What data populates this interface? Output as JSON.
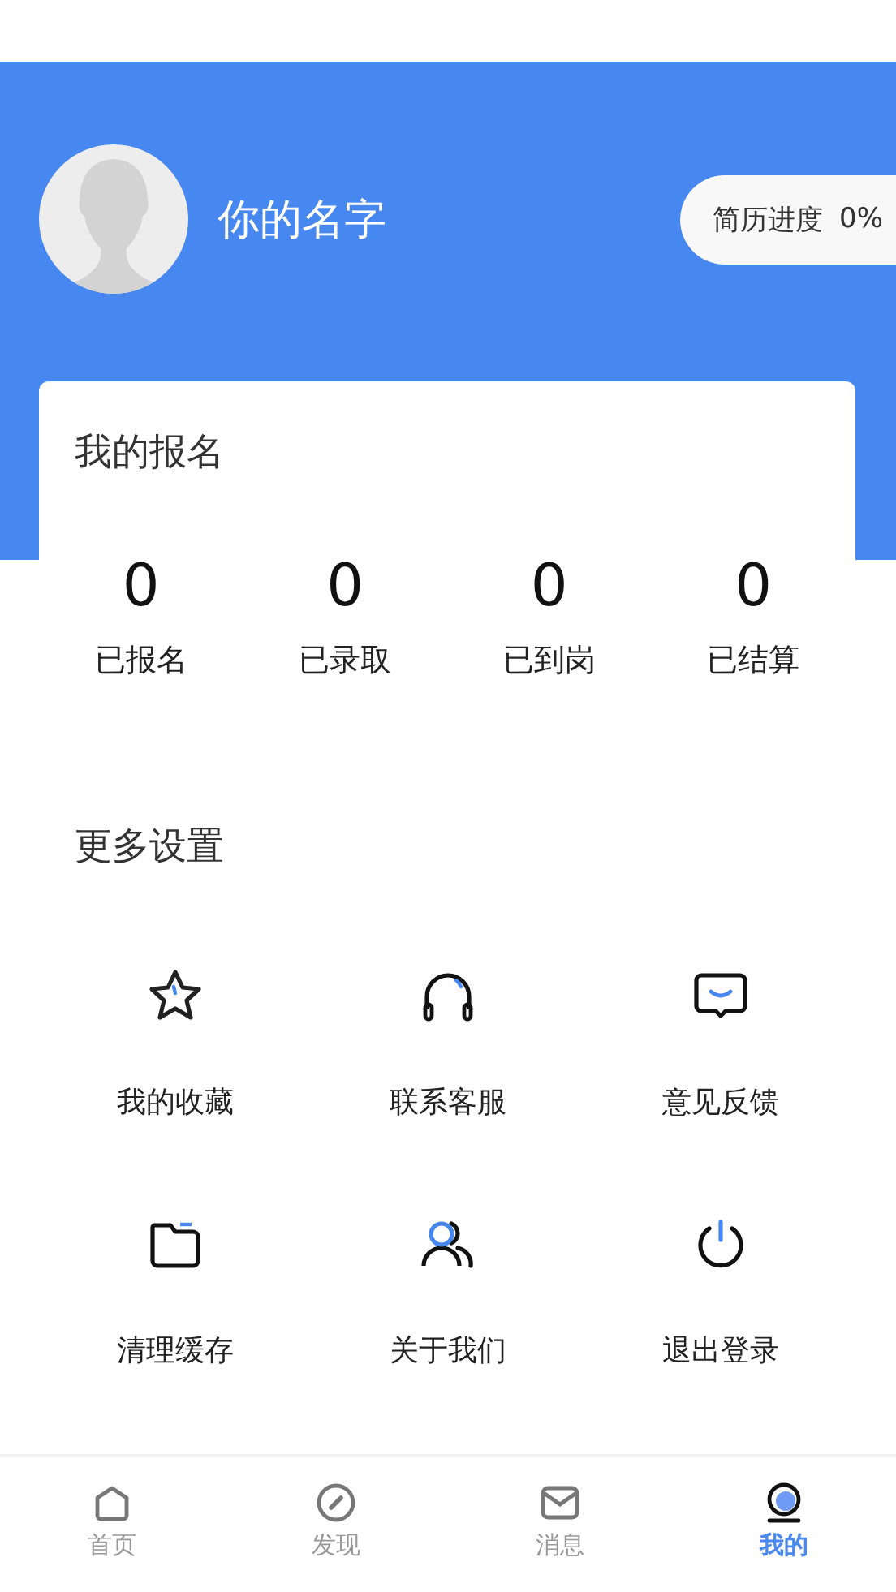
{
  "profile": {
    "name": "你的名字",
    "resume_progress": {
      "label": "简历进度",
      "value": "0%"
    }
  },
  "signup_card": {
    "title": "我的报名",
    "stats": [
      {
        "value": "0",
        "label": "已报名"
      },
      {
        "value": "0",
        "label": "已录取"
      },
      {
        "value": "0",
        "label": "已到岗"
      },
      {
        "value": "0",
        "label": "已结算"
      }
    ]
  },
  "more_settings": {
    "title": "更多设置",
    "items": [
      {
        "kind": "star",
        "label": "我的收藏"
      },
      {
        "kind": "headset",
        "label": "联系客服"
      },
      {
        "kind": "chat",
        "label": "意见反馈"
      },
      {
        "kind": "folder",
        "label": "清理缓存"
      },
      {
        "kind": "people",
        "label": "关于我们"
      },
      {
        "kind": "power",
        "label": "退出登录"
      }
    ]
  },
  "tab_bar": [
    {
      "kind": "home",
      "label": "首页",
      "selected": false
    },
    {
      "kind": "compass",
      "label": "发现",
      "selected": false
    },
    {
      "kind": "mail",
      "label": "消息",
      "selected": false
    },
    {
      "kind": "me",
      "label": "我的",
      "selected": true
    }
  ]
}
